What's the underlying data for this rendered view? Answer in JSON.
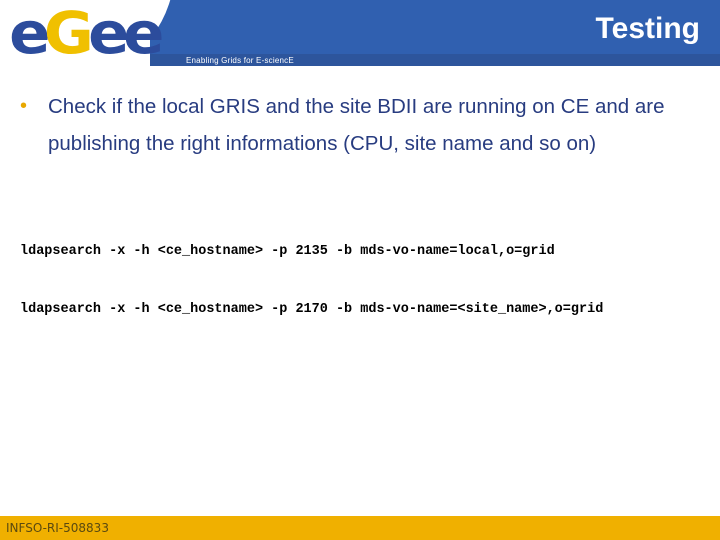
{
  "header": {
    "logo": {
      "letters": [
        "e",
        "G",
        "e",
        "e"
      ],
      "colors": [
        "#2c4c9c",
        "#f0c000",
        "#2c4c9c",
        "#2c4c9c"
      ]
    },
    "tagline": "Enabling Grids for E-sciencE",
    "title": "Testing",
    "colors": {
      "band": "#3060b0",
      "strip": "#2d559c"
    }
  },
  "main": {
    "bullets": [
      {
        "icon": "bullet-dot",
        "text": "Check if the local GRIS and the site BDII are running on CE and are publishing the right informations (CPU, site name and so on)"
      }
    ],
    "commands": [
      "ldapsearch -x -h <ce_hostname> -p 2135 -b mds-vo-name=local,o=grid",
      "ldapsearch -x -h <ce_hostname> -p 2170 -b mds-vo-name=<site_name>,o=grid"
    ]
  },
  "footer": {
    "text": "INFSO-RI-508833",
    "color": "#f0b000"
  }
}
